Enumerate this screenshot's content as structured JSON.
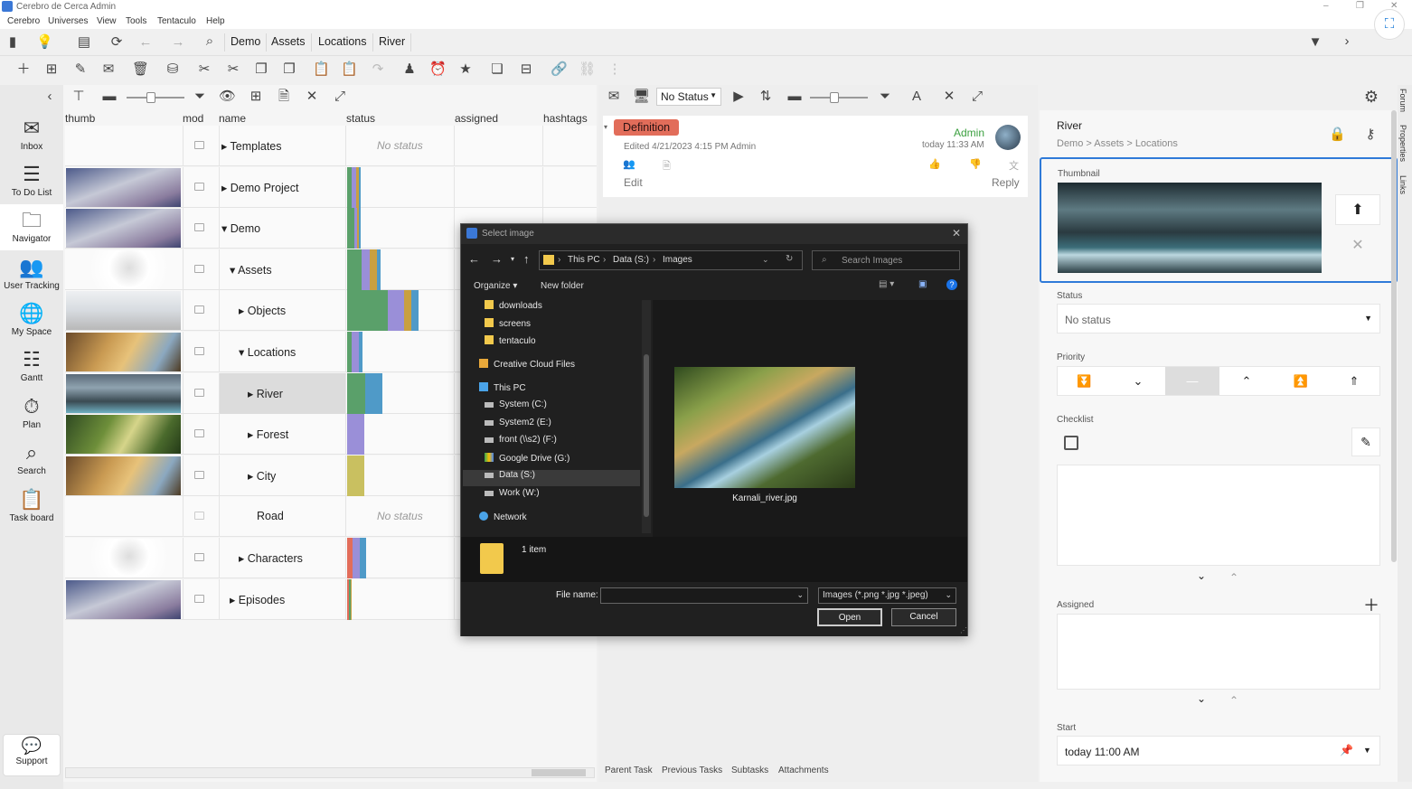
{
  "window": {
    "title": "Cerebro de Cerca  Admin",
    "minimize": "–",
    "maximize": "❐",
    "close": "✕"
  },
  "menu": [
    "Cerebro",
    "Universes",
    "View",
    "Tools",
    "Tentaculo",
    "Help"
  ],
  "breadcrumbs": [
    "Demo",
    "Assets",
    "Locations",
    "River"
  ],
  "nav": [
    {
      "label": "Inbox",
      "icon": "inbox-icon"
    },
    {
      "label": "To Do List",
      "icon": "list-icon"
    },
    {
      "label": "Navigator",
      "icon": "folder-icon"
    },
    {
      "label": "User Tracking",
      "icon": "users-icon"
    },
    {
      "label": "My Space",
      "icon": "globe-icon"
    },
    {
      "label": "Gantt",
      "icon": "gantt-icon"
    },
    {
      "label": "Plan",
      "icon": "plan-icon"
    },
    {
      "label": "Search",
      "icon": "search-icon"
    },
    {
      "label": "Task board",
      "icon": "clipboard-icon"
    }
  ],
  "support_label": "Support",
  "columns": [
    "thumb",
    "mod",
    "name",
    "status",
    "assigned",
    "hashtags"
  ],
  "rows": [
    {
      "name": "Templates",
      "status": "No status",
      "expand": "▸"
    },
    {
      "name": "Demo Project",
      "status": "",
      "expand": "▸"
    },
    {
      "name": "Demo",
      "status": "",
      "expand": "▾"
    },
    {
      "name": "Assets",
      "status": "",
      "expand": "▾"
    },
    {
      "name": "Objects",
      "status": "",
      "expand": "▸"
    },
    {
      "name": "Locations",
      "status": "",
      "expand": "▾"
    },
    {
      "name": "River",
      "status": "",
      "expand": "▸"
    },
    {
      "name": "Forest",
      "status": "",
      "expand": "▸"
    },
    {
      "name": "City",
      "status": "",
      "expand": "▸"
    },
    {
      "name": "Road",
      "status": "No status",
      "expand": ""
    },
    {
      "name": "Characters",
      "status": "",
      "expand": "▸"
    },
    {
      "name": "Episodes",
      "status": "",
      "expand": "▸"
    }
  ],
  "mid": {
    "status_filter": "No Status",
    "definition_label": "Definition",
    "edited": "Edited 4/21/2023 4:15 PM  Admin",
    "author": "Admin",
    "time": "today 11:33 AM",
    "edit": "Edit",
    "reply": "Reply",
    "bottom_tabs": [
      "Parent Task",
      "Previous Tasks",
      "Subtasks",
      "Attachments"
    ]
  },
  "right": {
    "title": "River",
    "path": "Demo > Assets > Locations",
    "thumbnail_label": "Thumbnail",
    "status_label": "Status",
    "status_value": "No status",
    "priority_label": "Priority",
    "checklist_label": "Checklist",
    "assigned_label": "Assigned",
    "start_label": "Start",
    "start_value": "today 11:00 AM",
    "vtabs": [
      "Forum",
      "Properties",
      "Links"
    ]
  },
  "dialog": {
    "title": "Select image",
    "path": [
      "This PC",
      "Data (S:)",
      "Images"
    ],
    "search_placeholder": "Search Images",
    "organize": "Organize ▾",
    "new_folder": "New folder",
    "tree": [
      {
        "label": "downloads",
        "type": "folder"
      },
      {
        "label": "screens",
        "type": "folder"
      },
      {
        "label": "tentaculo",
        "type": "folder"
      },
      {
        "label": "Creative Cloud Files",
        "type": "cloud"
      },
      {
        "label": "This PC",
        "type": "pc"
      },
      {
        "label": "System (C:)",
        "type": "drive"
      },
      {
        "label": "System2 (E:)",
        "type": "drive"
      },
      {
        "label": "front (\\\\s2) (F:)",
        "type": "drive"
      },
      {
        "label": "Google Drive (G:)",
        "type": "gdrive"
      },
      {
        "label": "Data (S:)",
        "type": "drive"
      },
      {
        "label": "Work (W:)",
        "type": "drive"
      },
      {
        "label": "Network",
        "type": "network"
      }
    ],
    "file_name": "Karnali_river.jpg",
    "status": "1 item",
    "file_name_label": "File name:",
    "file_name_value": "",
    "filter": "Images (*.png *.jpg *.jpeg)",
    "open": "Open",
    "cancel": "Cancel"
  }
}
